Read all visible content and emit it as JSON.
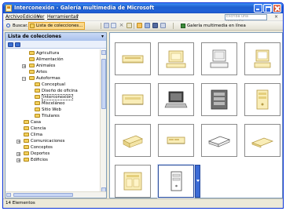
{
  "window": {
    "title": "Interconexión - Galería multimedia de Microsoft"
  },
  "menubar": {
    "items": [
      "Archivo",
      "Edición",
      "Ver",
      "Herramientas",
      "?"
    ],
    "help_placeholder": "Escriba una pregunta",
    "help_close": "×"
  },
  "toolbar": {
    "search_label": "Buscar...",
    "collection_list_label": "Lista de colecciones...",
    "web_gallery_label": "Galería multimedia en línea"
  },
  "left_panel": {
    "title": "Lista de colecciones",
    "tree": [
      {
        "label": "Agricultura"
      },
      {
        "label": "Alimentación"
      },
      {
        "label": "Animales"
      },
      {
        "label": "Artes"
      },
      {
        "label": "Autoformas"
      },
      {
        "label": "Conceptual"
      },
      {
        "label": "Diseño de oficina"
      },
      {
        "label": "Interconexión"
      },
      {
        "label": "Misceláneo"
      },
      {
        "label": "Sitio Web"
      },
      {
        "label": "Titulares"
      },
      {
        "label": "Casa"
      },
      {
        "label": "Ciencia"
      },
      {
        "label": "Clima"
      },
      {
        "label": "Comunicaciones"
      },
      {
        "label": "Conceptos"
      },
      {
        "label": "Deportes"
      },
      {
        "label": "Edificios"
      }
    ]
  },
  "clips": [
    {
      "icon": "network-cable-icon"
    },
    {
      "icon": "computer-monitor-icon"
    },
    {
      "icon": "computer-monitor-icon"
    },
    {
      "icon": "computer-monitor-icon"
    },
    {
      "icon": "network-hub-icon"
    },
    {
      "icon": "laptop-icon"
    },
    {
      "icon": "server-tower-icon"
    },
    {
      "icon": "server-tower-icon"
    },
    {
      "icon": "network-device-icon"
    },
    {
      "icon": "network-device-icon"
    },
    {
      "icon": "network-device-icon"
    },
    {
      "icon": "network-device-icon"
    },
    {
      "icon": "network-rack-icon"
    },
    {
      "icon": "computer-tower-icon"
    }
  ],
  "status": {
    "text": "14 Elementos"
  }
}
